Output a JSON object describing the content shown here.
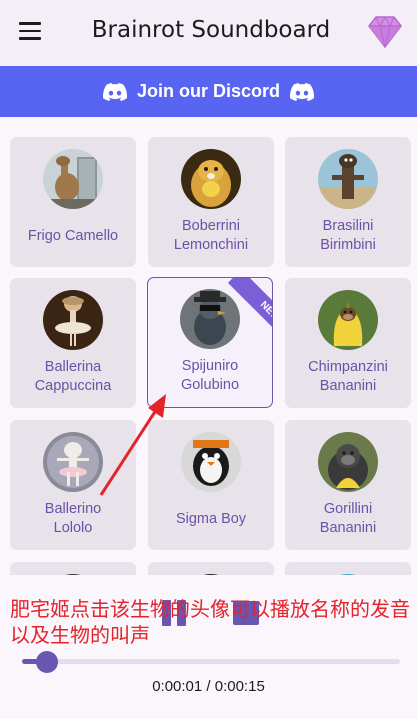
{
  "app_bar": {
    "title": "Brainrot Soundboard"
  },
  "discord_banner": {
    "label": "Join our Discord"
  },
  "grid": {
    "items": [
      {
        "name": "Frigo Camello",
        "lines": [
          "Frigo Camello"
        ]
      },
      {
        "name": "Boberrini Lemonchini",
        "lines": [
          "Boberrini",
          "Lemonchini"
        ]
      },
      {
        "name": "Brasilini Birimbini",
        "lines": [
          "Brasilini",
          "Birimbini"
        ]
      },
      {
        "name": "Ballerina Cappuccina",
        "lines": [
          "Ballerina",
          "Cappuccina"
        ]
      },
      {
        "name": "Spijuniro Golubino",
        "lines": [
          "Spijuniro",
          "Golubino"
        ],
        "badge": "NEW",
        "selected": true
      },
      {
        "name": "Chimpanzini Bananini",
        "lines": [
          "Chimpanzini",
          "Bananini"
        ]
      },
      {
        "name": "Ballerino Lololo",
        "lines": [
          "Ballerino",
          "Lololo"
        ]
      },
      {
        "name": "Sigma Boy",
        "lines": [
          "Sigma Boy"
        ]
      },
      {
        "name": "Gorillini Bananini",
        "lines": [
          "Gorillini",
          "Bananini"
        ]
      }
    ]
  },
  "player": {
    "elapsed": "0:00:01",
    "total": "0:00:15",
    "time_display": "0:00:01 / 0:00:15",
    "progress_fraction": 0.067
  },
  "annotation": {
    "text": "肥宅姬点击该生物的头像可以播放名称的发音以及生物的叫声",
    "color": "#e3242b"
  },
  "colors": {
    "discord": "#5865f2",
    "accent": "#6a55b0",
    "label": "#6b52a8",
    "card": "#e8e2ea",
    "gem": "#c77ddb"
  }
}
